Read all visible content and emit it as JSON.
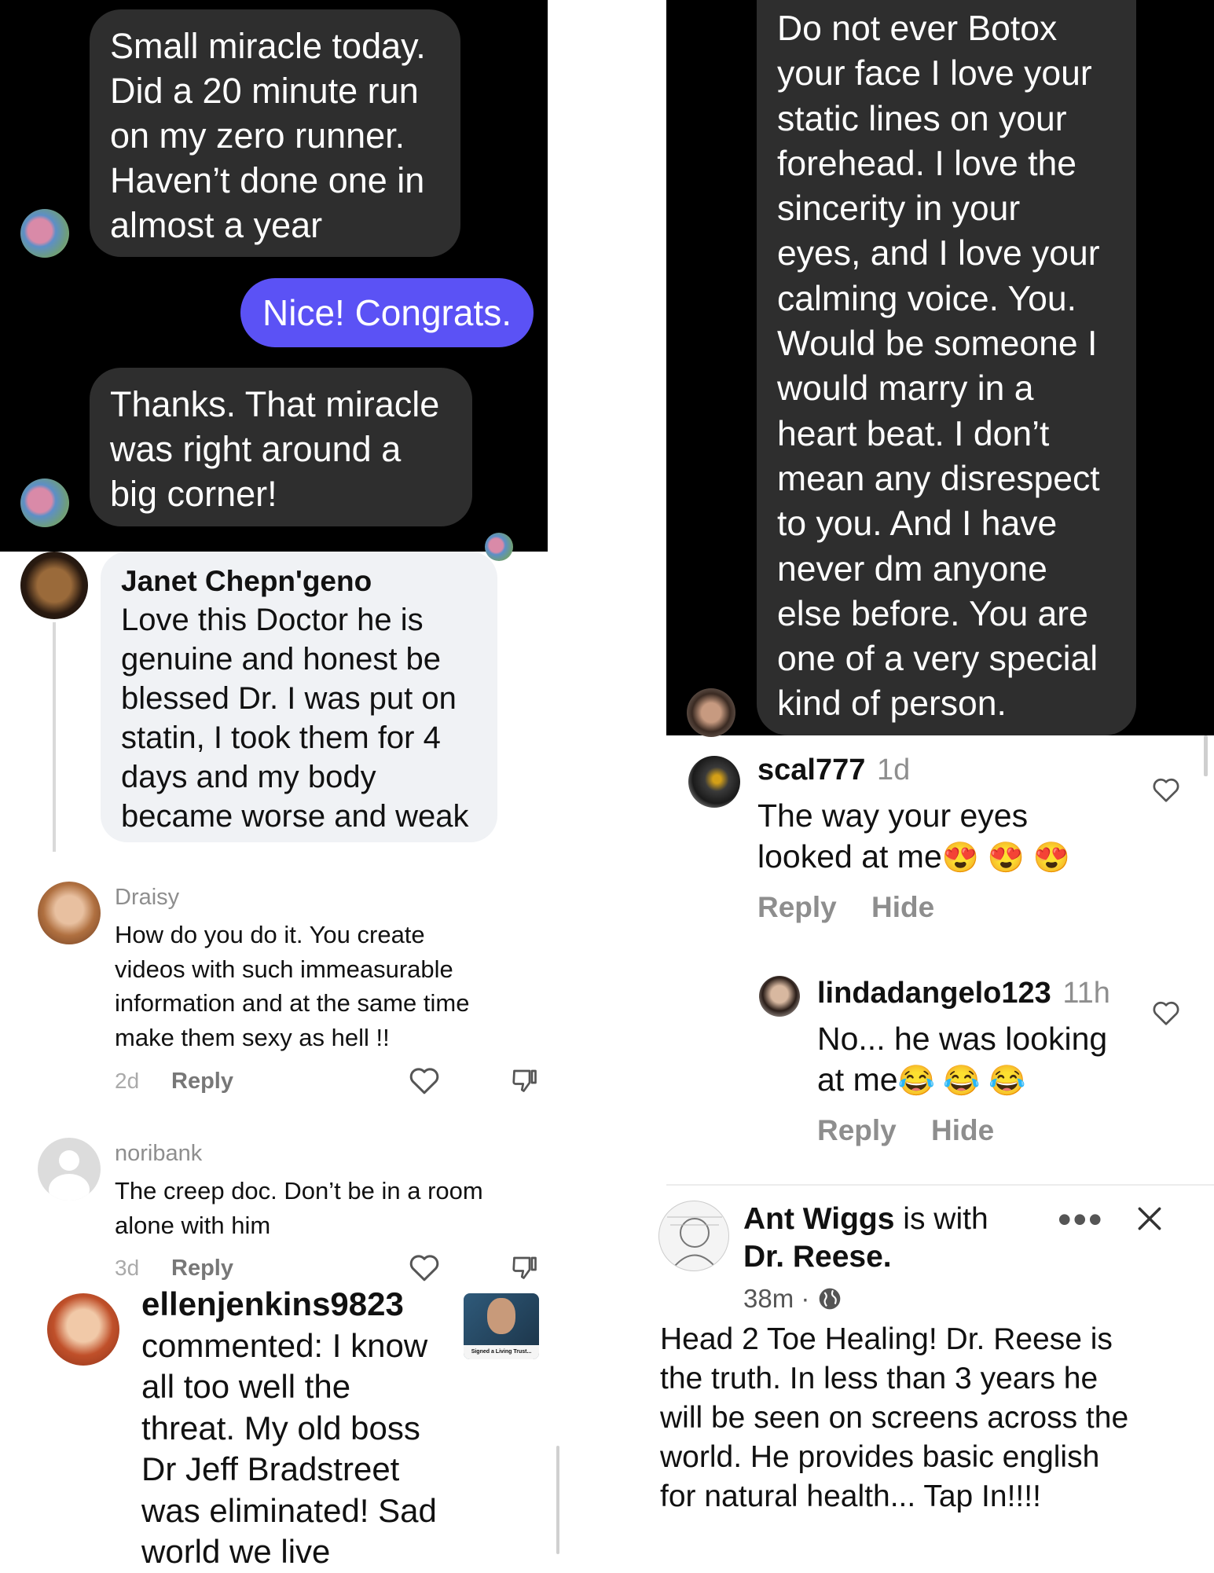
{
  "dm_left": {
    "messages": [
      {
        "lines": [
          "Small miracle today.",
          "Did a 20 minute run",
          "on my zero runner.",
          "Haven’t done one in",
          "almost a year"
        ]
      },
      {
        "text": "Nice! Congrats."
      },
      {
        "lines": [
          "Thanks. That miracle",
          "was right around a",
          "big corner!"
        ]
      }
    ]
  },
  "dm_right": {
    "lines": [
      "Do not ever Botox",
      "your face I love your",
      "static lines on your",
      "forehead.  I love the",
      "sincerity in your",
      "eyes, and I love your",
      "calming voice.   You.",
      "Would be someone I",
      "would marry in a",
      "heart beat.  I don’t",
      "mean any disrespect",
      "to you.  And I have",
      "never dm anyone",
      "else before. You are",
      "one of a very special",
      "kind of person."
    ]
  },
  "fb_comment": {
    "author": "Janet Chepn'geno",
    "lines": [
      "Love this Doctor he is",
      "genuine and honest be",
      "blessed Dr. I was put on",
      "statin, I took them for 4",
      "days and my body",
      "became worse and weak"
    ]
  },
  "yt_comments": [
    {
      "author": "Draisy",
      "lines": [
        "How do you do it. You create",
        "videos with such immeasurable",
        "information and at the same time",
        "make them sexy as hell !!"
      ],
      "age": "2d",
      "reply": "Reply"
    },
    {
      "author": "noribank",
      "lines": [
        "The creep doc. Don’t be in a room",
        "alone with him"
      ],
      "age": "3d",
      "reply": "Reply"
    }
  ],
  "notification": {
    "author": "ellenjenkins9823",
    "lines": [
      "commented: I know",
      "all too well the",
      "threat. My old boss",
      "Dr Jeff Bradstreet",
      "was eliminated! Sad",
      "world we live"
    ],
    "thumb_caption": "Signed a Living Trust..."
  },
  "ig_comments": [
    {
      "user": "scal777",
      "time": "1d",
      "lines": [
        "The way your eyes",
        "looked at me"
      ],
      "emoji": "😍 😍 😍",
      "reply": "Reply",
      "hide": "Hide"
    },
    {
      "user": "lindadangelo123",
      "time": "11h",
      "lines": [
        "No... he was looking",
        "at me"
      ],
      "emoji": "😂 😂 😂",
      "reply": "Reply",
      "hide": "Hide"
    }
  ],
  "fb_post": {
    "author": "Ant Wiggs",
    "with_text": "is with",
    "tagged": "Dr. Reese.",
    "time": "38m",
    "separator": "·",
    "lines": [
      "Head 2 Toe Healing! Dr. Reese is",
      "the truth. In less than 3 years he",
      "will be seen on screens across the",
      "world. He provides basic english",
      "for natural health... Tap In!!!!"
    ]
  },
  "colors": {
    "blue_bubble": "#5b52f5",
    "dark_bubble": "#2e2e2e",
    "muted": "#8e8e8e"
  }
}
